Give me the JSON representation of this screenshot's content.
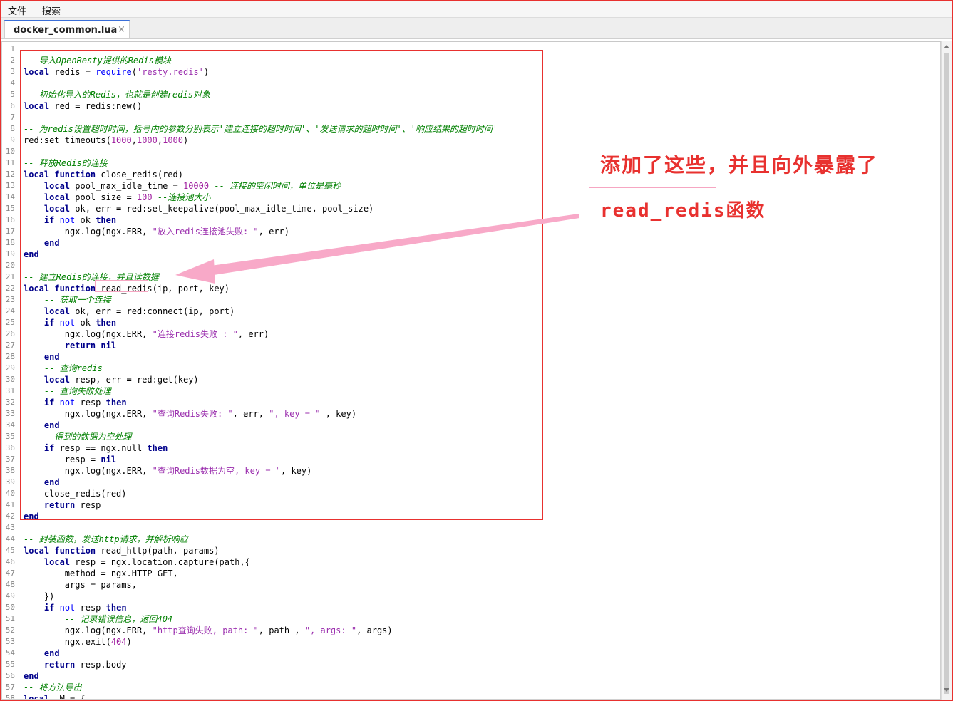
{
  "menu": {
    "file": "文件",
    "search": "搜索"
  },
  "tab": {
    "label": "docker_common.lua",
    "close": "×"
  },
  "annotation": {
    "line1": "添加了这些，并且向外暴露了",
    "line2_code": "read_redis",
    "line2_suffix": "函数"
  },
  "code_lines": [
    {
      "n": "1",
      "h": ""
    },
    {
      "n": "2",
      "h": "<span class='cm'>-- 导入OpenResty提供的Redis模块</span>"
    },
    {
      "n": "3",
      "h": "<span class='kw'>local</span> redis = <span class='kw2'>require</span>(<span class='st'>'resty.redis'</span>)"
    },
    {
      "n": "4",
      "h": ""
    },
    {
      "n": "5",
      "h": "<span class='cm'>-- 初始化导入的Redis，也就是创建redis对象</span>"
    },
    {
      "n": "6",
      "h": "<span class='kw'>local</span> red = redis:new()"
    },
    {
      "n": "7",
      "h": ""
    },
    {
      "n": "8",
      "h": "<span class='cm'>-- 为redis设置超时时间，括号内的参数分别表示'建立连接的超时时间'、'发送请求的超时时间'、'响应结果的超时时间'</span>"
    },
    {
      "n": "9",
      "h": "red:set_timeouts(<span class='num'>1000</span>,<span class='num'>1000</span>,<span class='num'>1000</span>)"
    },
    {
      "n": "10",
      "h": ""
    },
    {
      "n": "11",
      "h": "<span class='cm'>-- 释放Redis的连接</span>"
    },
    {
      "n": "12",
      "h": "<span class='kw'>local function</span> close_redis(red)"
    },
    {
      "n": "13",
      "h": "    <span class='kw'>local</span> pool_max_idle_time = <span class='num'>10000</span> <span class='cm'>-- 连接的空闲时间，单位是毫秒</span>"
    },
    {
      "n": "14",
      "h": "    <span class='kw'>local</span> pool_size = <span class='num'>100</span> <span class='cm'>--连接池大小</span>"
    },
    {
      "n": "15",
      "h": "    <span class='kw'>local</span> ok, err = red:set_keepalive(pool_max_idle_time, pool_size)"
    },
    {
      "n": "16",
      "h": "    <span class='kw'>if</span> <span class='kw2'>not</span> ok <span class='kw'>then</span>"
    },
    {
      "n": "17",
      "h": "        ngx.log(ngx.ERR, <span class='st'>\"放入redis连接池失败: \"</span>, err)"
    },
    {
      "n": "18",
      "h": "    <span class='kw'>end</span>"
    },
    {
      "n": "19",
      "h": "<span class='kw'>end</span>"
    },
    {
      "n": "20",
      "h": ""
    },
    {
      "n": "21",
      "h": "<span class='cm'>-- 建立Redis的连接，并且读数据</span>"
    },
    {
      "n": "22",
      "h": "<span class='kw'>local function</span> read_redis(ip, port, key)"
    },
    {
      "n": "23",
      "h": "    <span class='cm'>-- 获取一个连接</span>"
    },
    {
      "n": "24",
      "h": "    <span class='kw'>local</span> ok, err = red:connect(ip, port)"
    },
    {
      "n": "25",
      "h": "    <span class='kw'>if</span> <span class='kw2'>not</span> ok <span class='kw'>then</span>"
    },
    {
      "n": "26",
      "h": "        ngx.log(ngx.ERR, <span class='st'>\"连接redis失败 : \"</span>, err)"
    },
    {
      "n": "27",
      "h": "        <span class='kw'>return nil</span>"
    },
    {
      "n": "28",
      "h": "    <span class='kw'>end</span>"
    },
    {
      "n": "29",
      "h": "    <span class='cm'>-- 查询redis</span>"
    },
    {
      "n": "30",
      "h": "    <span class='kw'>local</span> resp, err = red:get(key)"
    },
    {
      "n": "31",
      "h": "    <span class='cm'>-- 查询失败处理</span>"
    },
    {
      "n": "32",
      "h": "    <span class='kw'>if</span> <span class='kw2'>not</span> resp <span class='kw'>then</span>"
    },
    {
      "n": "33",
      "h": "        ngx.log(ngx.ERR, <span class='st'>\"查询Redis失败: \"</span>, err, <span class='st'>\", key = \"</span> , key)"
    },
    {
      "n": "34",
      "h": "    <span class='kw'>end</span>"
    },
    {
      "n": "35",
      "h": "    <span class='cm'>--得到的数据为空处理</span>"
    },
    {
      "n": "36",
      "h": "    <span class='kw'>if</span> resp == ngx.null <span class='kw'>then</span>"
    },
    {
      "n": "37",
      "h": "        resp = <span class='kw'>nil</span>"
    },
    {
      "n": "38",
      "h": "        ngx.log(ngx.ERR, <span class='st'>\"查询Redis数据为空, key = \"</span>, key)"
    },
    {
      "n": "39",
      "h": "    <span class='kw'>end</span>"
    },
    {
      "n": "40",
      "h": "    close_redis(red)"
    },
    {
      "n": "41",
      "h": "    <span class='kw'>return</span> resp"
    },
    {
      "n": "42",
      "h": "<span class='kw'>end</span>"
    },
    {
      "n": "43",
      "h": ""
    },
    {
      "n": "44",
      "h": "<span class='cm'>-- 封装函数，发送http请求，并解析响应</span>"
    },
    {
      "n": "45",
      "h": "<span class='kw'>local function</span> read_http(path, params)"
    },
    {
      "n": "46",
      "h": "    <span class='kw'>local</span> resp = ngx.location.capture(path,{"
    },
    {
      "n": "47",
      "h": "        method = ngx.HTTP_GET,"
    },
    {
      "n": "48",
      "h": "        args = params,"
    },
    {
      "n": "49",
      "h": "    })"
    },
    {
      "n": "50",
      "h": "    <span class='kw'>if</span> <span class='kw2'>not</span> resp <span class='kw'>then</span>"
    },
    {
      "n": "51",
      "h": "        <span class='cm'>-- 记录错误信息，返回404</span>"
    },
    {
      "n": "52",
      "h": "        ngx.log(ngx.ERR, <span class='st'>\"http查询失败, path: \"</span>, path , <span class='st'>\", args: \"</span>, args)"
    },
    {
      "n": "53",
      "h": "        ngx.exit(<span class='num'>404</span>)"
    },
    {
      "n": "54",
      "h": "    <span class='kw'>end</span>"
    },
    {
      "n": "55",
      "h": "    <span class='kw'>return</span> resp.body"
    },
    {
      "n": "56",
      "h": "<span class='kw'>end</span>"
    },
    {
      "n": "57",
      "h": "<span class='cm'>-- 将方法导出</span>"
    },
    {
      "n": "58",
      "h": "<span class='kw'>local</span> _M = {"
    }
  ]
}
